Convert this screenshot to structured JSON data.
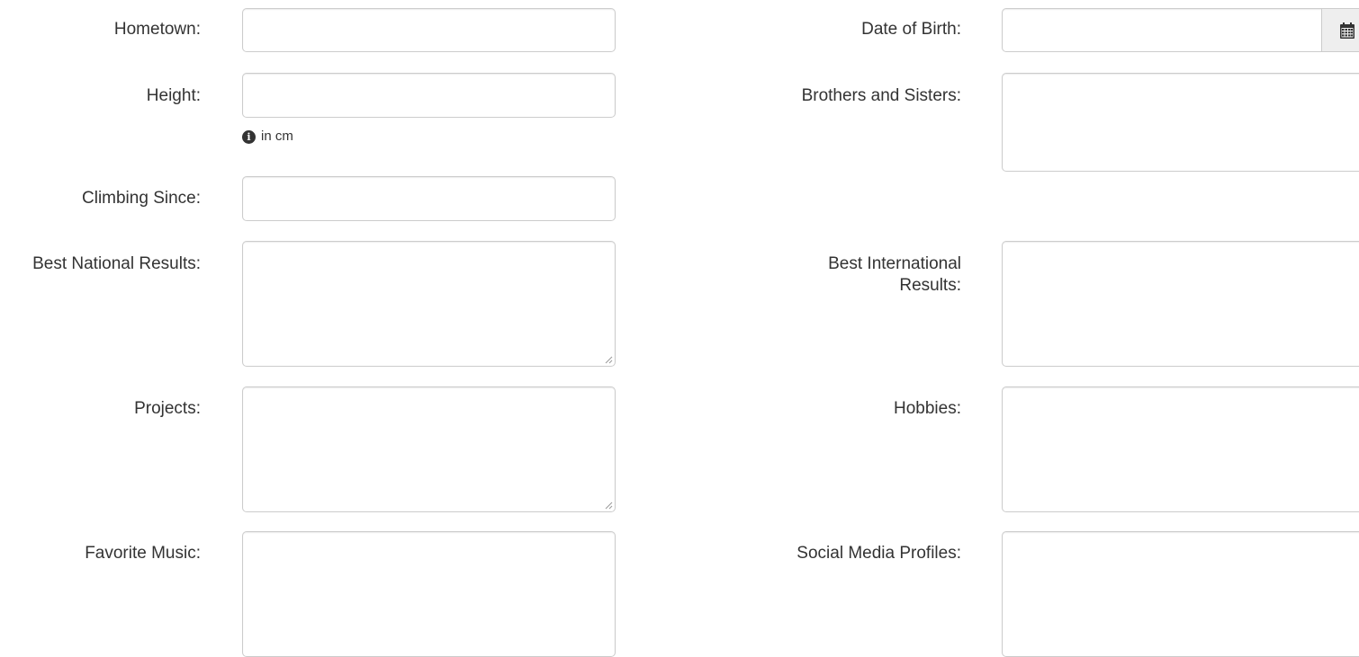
{
  "form": {
    "left": {
      "hometown": {
        "label": "Hometown:",
        "value": ""
      },
      "height": {
        "label": "Height:",
        "value": "",
        "help_text": "in cm",
        "help_icon": "info-circle-icon"
      },
      "climbing_since": {
        "label": "Climbing Since:",
        "value": ""
      },
      "best_national_results": {
        "label": "Best National Results:",
        "value": ""
      },
      "projects": {
        "label": "Projects:",
        "value": ""
      },
      "favorite_music": {
        "label": "Favorite Music:",
        "value": ""
      }
    },
    "right": {
      "date_of_birth": {
        "label": "Date of Birth:",
        "value": "",
        "addon_icon": "calendar-icon"
      },
      "brothers_and_sisters": {
        "label": "Brothers and Sisters:",
        "value": ""
      },
      "best_international_results": {
        "label": "Best International Results:",
        "value": ""
      },
      "hobbies": {
        "label": "Hobbies:",
        "value": ""
      },
      "social_media_profiles": {
        "label": "Social Media Profiles:",
        "value": ""
      }
    }
  },
  "colors": {
    "text": "#333333",
    "border": "#cccccc",
    "addon_background": "#eeeeee",
    "page_background": "#ffffff"
  }
}
